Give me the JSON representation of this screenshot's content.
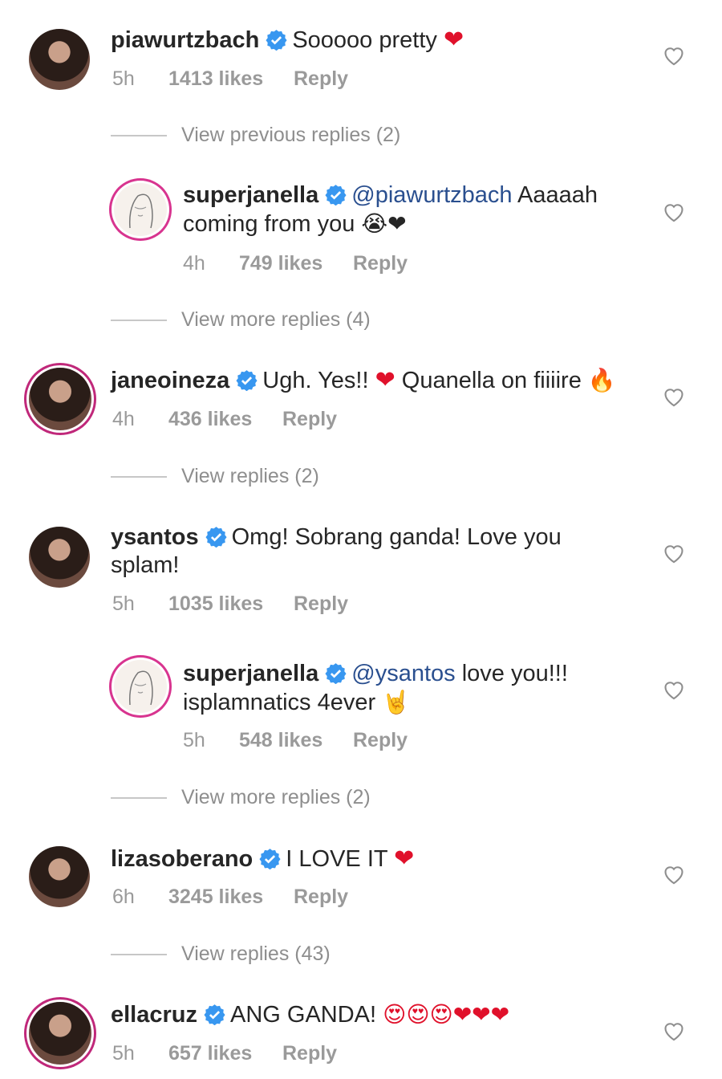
{
  "comments": [
    {
      "username": "piawurtzbach",
      "text": "Sooooo pretty",
      "emoji": "❤",
      "time": "5h",
      "likes": "1413 likes",
      "reply": "Reply"
    },
    {
      "view_label": "View previous replies (2)"
    },
    {
      "username": "superjanella",
      "mention": "@piawurtzbach",
      "text": "Aaaaah coming from you",
      "emoji": "😭❤",
      "time": "4h",
      "likes": "749 likes",
      "reply": "Reply"
    },
    {
      "view_label": "View more replies (4)"
    },
    {
      "username": "janeoineza",
      "text": "Ugh. Yes!!",
      "emoji1": "❤",
      "text2": "Quanella on fiiiire",
      "emoji2": "🔥",
      "time": "4h",
      "likes": "436 likes",
      "reply": "Reply"
    },
    {
      "view_label": "View replies (2)"
    },
    {
      "username": "ysantos",
      "text": "Omg! Sobrang ganda! Love you splam!",
      "time": "5h",
      "likes": "1035 likes",
      "reply": "Reply"
    },
    {
      "username": "superjanella",
      "mention": "@ysantos",
      "text": "love you!!! isplamnatics 4ever",
      "emoji": "🤘",
      "time": "5h",
      "likes": "548 likes",
      "reply": "Reply"
    },
    {
      "view_label": "View more replies (2)"
    },
    {
      "username": "lizasoberano",
      "text": "I LOVE IT",
      "emoji": "❤",
      "time": "6h",
      "likes": "3245 likes",
      "reply": "Reply"
    },
    {
      "view_label": "View replies (43)"
    },
    {
      "username": "ellacruz",
      "text": "ANG GANDA!",
      "emoji": "😍😍😍❤❤❤",
      "time": "5h",
      "likes": "657 likes",
      "reply": "Reply"
    }
  ],
  "icons": {
    "verified": "verified-badge-icon",
    "like": "heart-outline-icon"
  },
  "colors": {
    "verified": "#3897f0",
    "mention": "#2a4f8f",
    "heart": "#e0112b",
    "meta": "#9a9a9a"
  }
}
